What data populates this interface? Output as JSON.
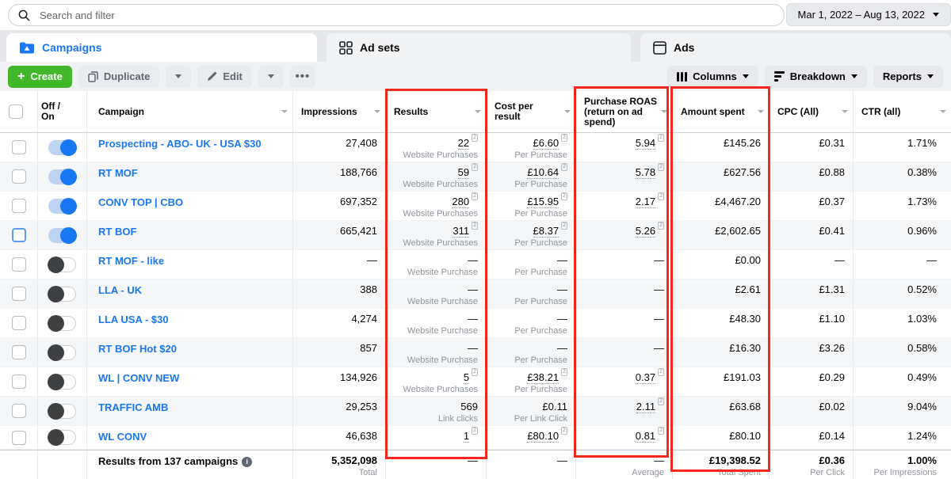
{
  "colors": {
    "accent": "#1877f2",
    "create_green": "#42b72a",
    "highlight_red": "#f5281b"
  },
  "topbar": {
    "search_placeholder": "Search and filter",
    "date_range": "Mar 1, 2022 – Aug 13, 2022"
  },
  "tabs": [
    {
      "label": "Campaigns",
      "active": true
    },
    {
      "label": "Ad sets",
      "active": false
    },
    {
      "label": "Ads",
      "active": false
    }
  ],
  "toolbar": {
    "create_label": "Create",
    "duplicate_label": "Duplicate",
    "edit_label": "Edit",
    "more_label": "•••",
    "columns_label": "Columns",
    "breakdown_label": "Breakdown",
    "reports_label": "Reports"
  },
  "table": {
    "headers": {
      "off_on": "Off / On",
      "campaign": "Campaign",
      "impressions": "Impressions",
      "results": "Results",
      "cost_per_result": "Cost per result",
      "roas": "Purchase ROAS (return on ad spend)",
      "amount_spent": "Amount spent",
      "cpc": "CPC (All)",
      "ctr": "CTR (all)"
    },
    "rows": [
      {
        "name": "Prospecting - ABO- UK - USA $30",
        "on": true,
        "impressions": "27,408",
        "results": "22",
        "results_sup": "2",
        "results_label": "Website Purchases",
        "cpr": "£6.60",
        "cpr_sup": "2",
        "cpr_label": "Per Purchase",
        "roas": "5.94",
        "roas_sup": "2",
        "spent": "£145.26",
        "cpc": "£0.31",
        "ctr": "1.71%"
      },
      {
        "name": "RT MOF",
        "on": true,
        "impressions": "188,766",
        "results": "59",
        "results_sup": "2",
        "results_label": "Website Purchases",
        "cpr": "£10.64",
        "cpr_sup": "2",
        "cpr_label": "Per Purchase",
        "roas": "5.78",
        "roas_sup": "2",
        "spent": "£627.56",
        "cpc": "£0.88",
        "ctr": "0.38%"
      },
      {
        "name": "CONV TOP | CBO",
        "on": true,
        "impressions": "697,352",
        "results": "280",
        "results_sup": "2",
        "results_label": "Website Purchases",
        "cpr": "£15.95",
        "cpr_sup": "2",
        "cpr_label": "Per Purchase",
        "roas": "2.17",
        "roas_sup": "2",
        "spent": "£4,467.20",
        "cpc": "£0.37",
        "ctr": "1.73%"
      },
      {
        "name": "RT BOF",
        "on": true,
        "checkbox_focus": true,
        "impressions": "665,421",
        "results": "311",
        "results_sup": "2",
        "results_label": "Website Purchases",
        "cpr": "£8.37",
        "cpr_sup": "2",
        "cpr_label": "Per Purchase",
        "roas": "5.26",
        "roas_sup": "2",
        "spent": "£2,602.65",
        "cpc": "£0.41",
        "ctr": "0.96%"
      },
      {
        "name": "RT MOF - like",
        "on": false,
        "impressions": "—",
        "results": "—",
        "results_label": "Website Purchase",
        "cpr": "—",
        "cpr_label": "Per Purchase",
        "roas": "—",
        "spent": "£0.00",
        "cpc": "—",
        "ctr": "—"
      },
      {
        "name": "LLA - UK",
        "on": false,
        "impressions": "388",
        "results": "—",
        "results_label": "Website Purchase",
        "cpr": "—",
        "cpr_label": "Per Purchase",
        "roas": "—",
        "spent": "£2.61",
        "cpc": "£1.31",
        "ctr": "0.52%"
      },
      {
        "name": "LLA USA - $30",
        "on": false,
        "impressions": "4,274",
        "results": "—",
        "results_label": "Website Purchase",
        "cpr": "—",
        "cpr_label": "Per Purchase",
        "roas": "—",
        "spent": "£48.30",
        "cpc": "£1.10",
        "ctr": "1.03%"
      },
      {
        "name": "RT BOF Hot $20",
        "on": false,
        "impressions": "857",
        "results": "—",
        "results_label": "Website Purchase",
        "cpr": "—",
        "cpr_label": "Per Purchase",
        "roas": "—",
        "spent": "£16.30",
        "cpc": "£3.26",
        "ctr": "0.58%"
      },
      {
        "name": "WL | CONV NEW",
        "on": false,
        "impressions": "134,926",
        "results": "5",
        "results_sup": "2",
        "results_label": "Website Purchases",
        "cpr": "£38.21",
        "cpr_sup": "2",
        "cpr_label": "Per Purchase",
        "roas": "0.37",
        "roas_sup": "2",
        "spent": "£191.03",
        "cpc": "£0.29",
        "ctr": "0.49%"
      },
      {
        "name": "TRAFFIC AMB",
        "on": false,
        "impressions": "29,253",
        "results": "569",
        "results_label": "Link clicks",
        "cpr": "£0.11",
        "cpr_label": "Per Link Click",
        "roas": "2.11",
        "roas_sup": "2",
        "spent": "£63.68",
        "cpc": "£0.02",
        "ctr": "9.04%"
      },
      {
        "name": "WL CONV",
        "on": false,
        "short": true,
        "impressions": "46,638",
        "results": "1",
        "results_sup": "2",
        "cpr": "£80.10",
        "cpr_sup": "2",
        "roas": "0.81",
        "roas_sup": "2",
        "spent": "£80.10",
        "cpc": "£0.14",
        "ctr": "1.24%"
      }
    ],
    "footer": {
      "label": "Results from 137 campaigns",
      "impressions": "5,352,098",
      "impressions_sub": "Total",
      "results": "—",
      "cpr": "—",
      "roas": "—",
      "roas_sub": "Average",
      "spent": "£19,398.52",
      "spent_sub": "Total Spent",
      "cpc": "£0.36",
      "cpc_sub": "Per Click",
      "ctr": "1.00%",
      "ctr_sub": "Per Impressions"
    }
  }
}
